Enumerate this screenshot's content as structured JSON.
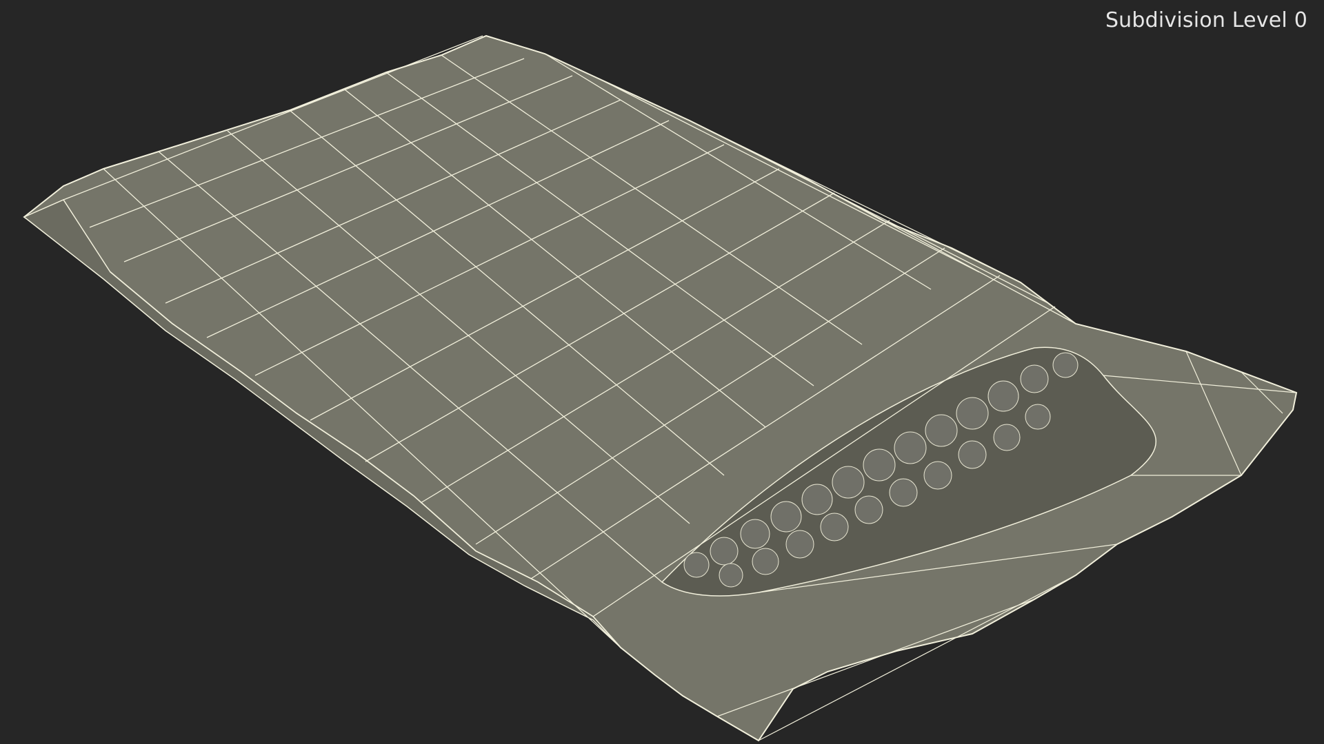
{
  "viewport": {
    "overlay_label": "Subdivision Level 0",
    "background_color": "#262626",
    "mesh_fill_color": "#757569",
    "mesh_shadow_color": "#5c5c52",
    "wire_color": "#f2f0dc",
    "inner_fill_color": "#6a6a60"
  },
  "model": {
    "name": "bubble-mailer-envelope-icon",
    "display_mode": "wireframe-on-shaded"
  }
}
